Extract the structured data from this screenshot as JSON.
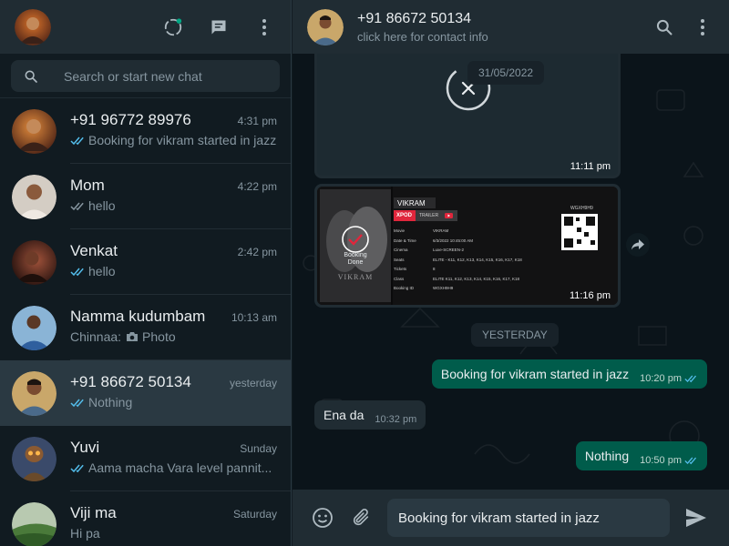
{
  "sidebar": {
    "search_placeholder": "Search or start new chat",
    "chats": [
      {
        "name": "+91 96772 89976",
        "time": "4:31 pm",
        "preview": "Booking for vikram started in jazz",
        "tick": "blue",
        "active": false
      },
      {
        "name": "Mom",
        "time": "4:22 pm",
        "preview": "hello",
        "tick": "grey",
        "active": false
      },
      {
        "name": "Venkat",
        "time": "2:42 pm",
        "preview": "hello",
        "tick": "blue",
        "active": false
      },
      {
        "name": "Namma kudumbam",
        "time": "10:13 am",
        "sender": "Chinnaa:",
        "preview": "Photo",
        "tick": "none",
        "active": false
      },
      {
        "name": "+91 86672 50134",
        "time": "yesterday",
        "preview": "Nothing",
        "tick": "blue",
        "active": true
      },
      {
        "name": "Yuvi",
        "time": "Sunday",
        "preview": "Aama macha Vara level pannit...",
        "tick": "blue",
        "active": false
      },
      {
        "name": "Viji ma",
        "time": "Saturday",
        "preview": "Hi pa",
        "tick": "none",
        "active": false
      }
    ]
  },
  "conversation": {
    "contact_name": "+91 86672 50134",
    "contact_sub": "click here for contact info",
    "media_date": "31/05/2022",
    "media1_time": "11:11 pm",
    "media2_time": "11:16 pm",
    "ticket": {
      "movie_title": "VIKRAM",
      "booking_done_line1": "Booking",
      "booking_done_line2": "Done",
      "badge_primary": "XPOD",
      "badge_trailer": "TRAILER",
      "poster_title": "VIKRAM",
      "booking_code": "WGXH9H9",
      "fields": [
        {
          "label": "Movie",
          "value": "VIKRAM"
        },
        {
          "label": "Date & Time",
          "value": "6/3/2022 10:45:00 AM"
        },
        {
          "label": "Cinema",
          "value": "Luxe-SCREEN-2"
        },
        {
          "label": "Seats",
          "value": "ELITE - K11, K12, K13, K14, K15, K16, K17, K18"
        },
        {
          "label": "Tickets",
          "value": "8"
        },
        {
          "label": "Class",
          "value": "ELITE K11, K12, K13, K14, K15, K16, K17, K18"
        },
        {
          "label": "Booking ID",
          "value": "WGXH9H9"
        }
      ]
    },
    "yesterday_label": "YESTERDAY",
    "messages": [
      {
        "dir": "out",
        "text": "Booking for vikram started in jazz",
        "time": "10:20 pm"
      },
      {
        "dir": "in",
        "text": "Ena da",
        "time": "10:32 pm"
      },
      {
        "dir": "out",
        "text": "Nothing",
        "time": "10:50 pm"
      }
    ],
    "composer_value": "Booking for vikram started in jazz"
  },
  "colors": {
    "panel": "#202c33",
    "background": "#111b21",
    "chat_background": "#0b141a",
    "outgoing_bubble": "#005c4b",
    "incoming_bubble": "#202c33",
    "read_tick": "#53bdeb",
    "accent": "#00a884"
  },
  "icons": {
    "status": "status-icon",
    "new_chat": "new-chat-icon",
    "menu": "menu-icon",
    "search": "search-icon",
    "emoji": "emoji-icon",
    "attach": "attach-icon",
    "send": "send-icon",
    "forward": "forward-icon",
    "cancel_download": "cancel-download-icon",
    "photo": "camera-icon"
  }
}
